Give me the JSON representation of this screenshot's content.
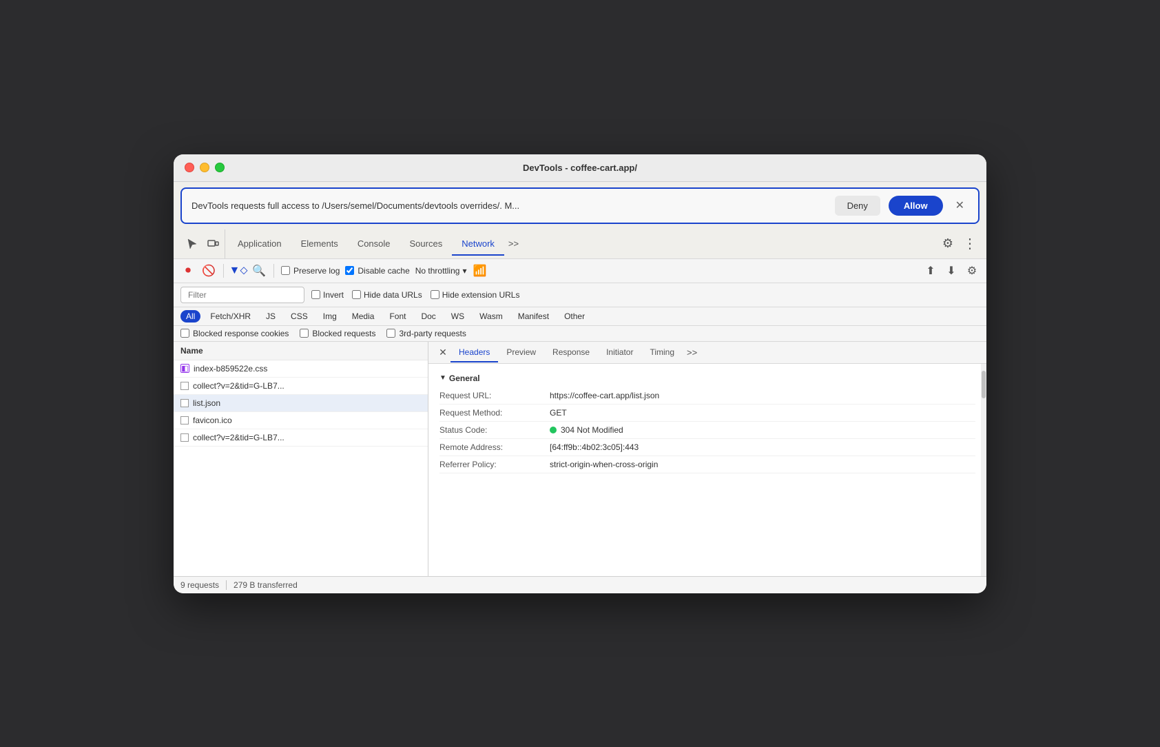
{
  "window": {
    "title": "DevTools - coffee-cart.app/"
  },
  "permission": {
    "text": "DevTools requests full access to /Users/semel/Documents/devtools overrides/. M...",
    "deny_label": "Deny",
    "allow_label": "Allow"
  },
  "nav": {
    "tabs": [
      {
        "label": "Application",
        "active": false
      },
      {
        "label": "Elements",
        "active": false
      },
      {
        "label": "Console",
        "active": false
      },
      {
        "label": "Sources",
        "active": false
      },
      {
        "label": "Network",
        "active": true
      }
    ],
    "more": ">>"
  },
  "network_toolbar": {
    "preserve_log_label": "Preserve log",
    "disable_cache_label": "Disable cache",
    "throttle_label": "No throttling"
  },
  "filter": {
    "placeholder": "Filter",
    "invert_label": "Invert",
    "hide_data_urls_label": "Hide data URLs",
    "hide_ext_label": "Hide extension URLs"
  },
  "type_filters": [
    "All",
    "Fetch/XHR",
    "JS",
    "CSS",
    "Img",
    "Media",
    "Font",
    "Doc",
    "WS",
    "Wasm",
    "Manifest",
    "Other"
  ],
  "blocked_filters": {
    "blocked_cookies_label": "Blocked response cookies",
    "blocked_requests_label": "Blocked requests",
    "third_party_label": "3rd-party requests"
  },
  "file_list": {
    "header": "Name",
    "items": [
      {
        "name": "index-b859522e.css",
        "type": "css"
      },
      {
        "name": "collect?v=2&tid=G-LB7...",
        "type": "checkbox"
      },
      {
        "name": "list.json",
        "type": "checkbox"
      },
      {
        "name": "favicon.ico",
        "type": "checkbox"
      },
      {
        "name": "collect?v=2&tid=G-LB7...",
        "type": "checkbox"
      }
    ]
  },
  "detail": {
    "tabs": [
      "Headers",
      "Preview",
      "Response",
      "Initiator",
      "Timing"
    ],
    "active_tab": "Headers",
    "section_title": "General",
    "rows": [
      {
        "key": "Request URL:",
        "value": "https://coffee-cart.app/list.json"
      },
      {
        "key": "Request Method:",
        "value": "GET"
      },
      {
        "key": "Status Code:",
        "value": "304 Not Modified",
        "has_dot": true
      },
      {
        "key": "Remote Address:",
        "value": "[64:ff9b::4b02:3c05]:443"
      },
      {
        "key": "Referrer Policy:",
        "value": "strict-origin-when-cross-origin"
      }
    ]
  },
  "status_bar": {
    "requests": "9 requests",
    "transferred": "279 B transferred"
  }
}
